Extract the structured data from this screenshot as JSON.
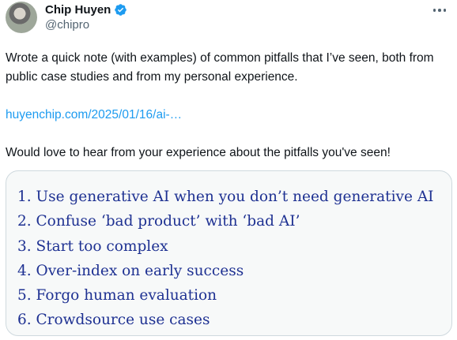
{
  "author": {
    "name": "Chip Huyen",
    "handle": "@chipro",
    "verified": true,
    "avatar_icon": "profile-photo"
  },
  "tweet": {
    "line1": "Wrote a quick note (with examples) of common pitfalls that I’ve seen, both from public case studies and from my personal experience.",
    "link": "huyenchip.com/2025/01/16/ai-…",
    "line2": "Would love to hear from your experience about the pitfalls you've seen!"
  },
  "media": {
    "items": [
      "1. Use generative AI when you don’t need generative AI",
      "2. Confuse ‘bad product’ with ‘bad AI’",
      "3. Start too complex",
      "4. Over-index on early success",
      "5. Forgo human evaluation",
      "6. Crowdsource use cases"
    ]
  },
  "colors": {
    "link": "#1d9bf0",
    "verified": "#1d9bf0",
    "list_text": "#1e3192"
  }
}
